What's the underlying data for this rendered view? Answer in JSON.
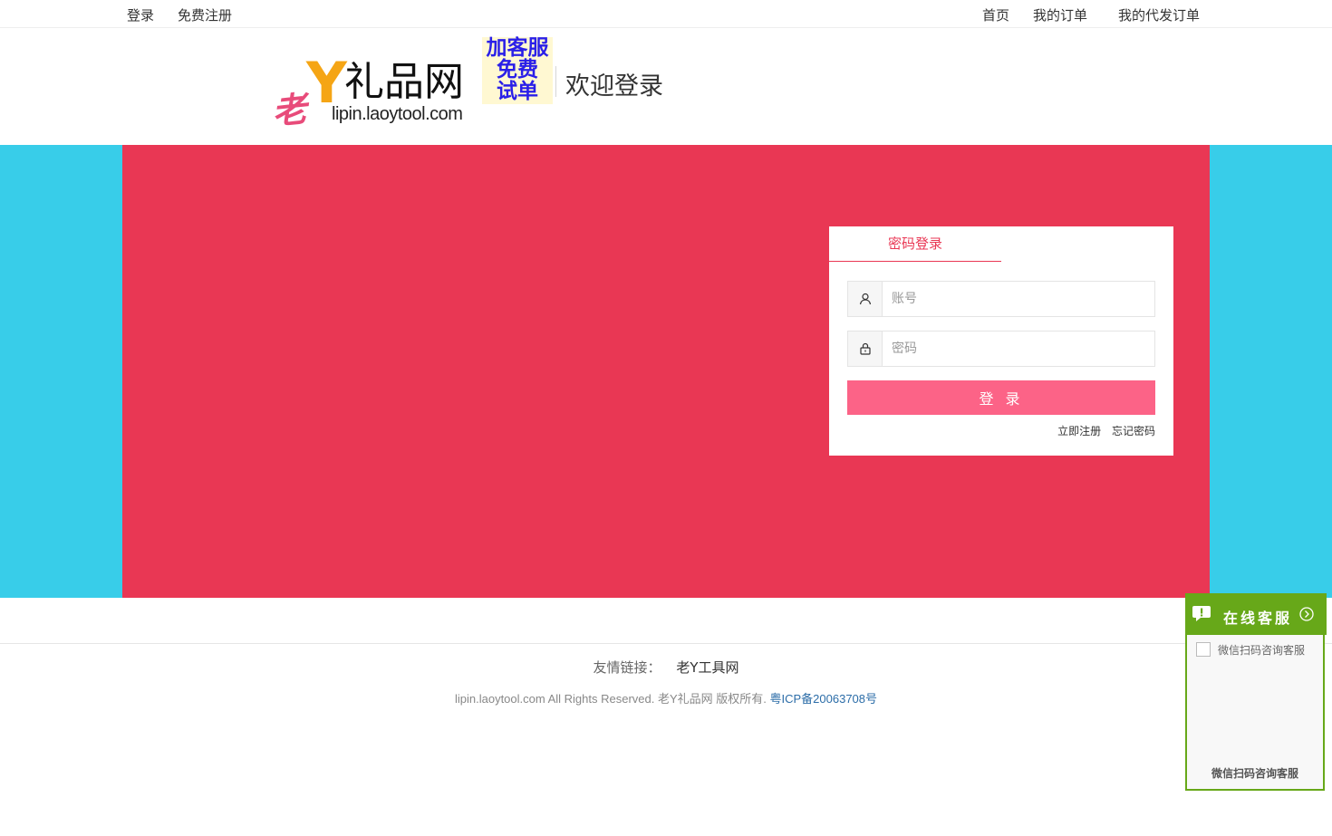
{
  "topbar": {
    "login": "登录",
    "register": "免费注册",
    "home": "首页",
    "my_orders": "我的订单",
    "my_dropship_orders": "我的代发订单"
  },
  "header": {
    "logo_lao": "老",
    "logo_y": "Y",
    "logo_name": "礼品网",
    "logo_url": "lipin.laoytool.com",
    "promo_line1": "加客服",
    "promo_line2": "免费",
    "promo_line3": "试单",
    "welcome": "欢迎登录"
  },
  "login": {
    "tab_password": "密码登录",
    "account_placeholder": "账号",
    "password_placeholder": "密码",
    "submit": "登 录",
    "register_now": "立即注册",
    "forgot_password": "忘记密码"
  },
  "footer": {
    "friend_links_label": "友情链接：",
    "friend_link_1": "老Y工具网",
    "copyright": "lipin.laoytool.com All Rights Reserved. 老Y礼品网 版权所有.",
    "icp": "粤ICP备20063708号"
  },
  "service": {
    "title": "在线客服",
    "image_alt": "微信扫码咨询客服",
    "caption": "微信扫码咨询客服"
  },
  "colors": {
    "banner_side": "#38cde9",
    "banner_center": "#e93754",
    "login_button": "#fc6387",
    "service_green": "#67a819"
  }
}
